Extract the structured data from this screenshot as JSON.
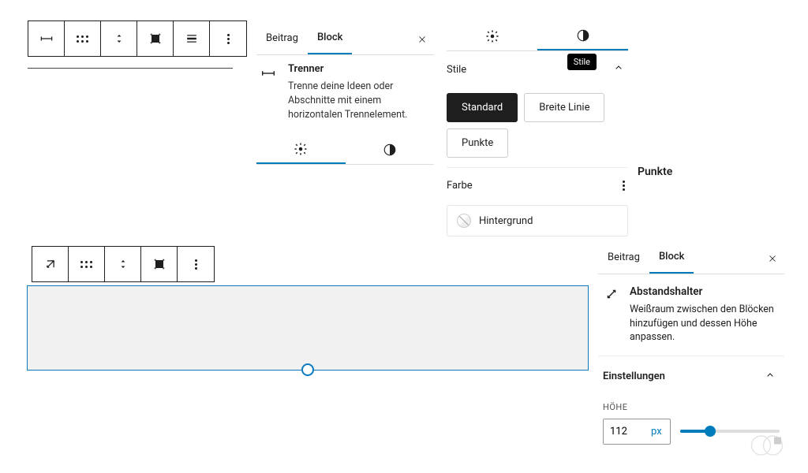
{
  "tabs": {
    "beitrag": "Beitrag",
    "block": "Block"
  },
  "trenner": {
    "title": "Trenner",
    "desc": "Trenne deine Ideen oder Abschnitte mit einem horizontalen Trennelement."
  },
  "stile": {
    "label": "Stile",
    "tooltip": "Stile",
    "options": {
      "standard": "Standard",
      "breite": "Breite Linie",
      "punkte": "Punkte"
    }
  },
  "farbe": {
    "label": "Farbe",
    "hintergrund": "Hintergrund"
  },
  "punkte_floating": "Punkte",
  "abstand": {
    "title": "Abstandshalter",
    "desc": "Weißraum zwischen den Blöcken hinzufügen und dessen Höhe anpassen."
  },
  "einst": "Einstellungen",
  "hoehe": {
    "label": "HÖHE",
    "value": "112",
    "unit": "px"
  }
}
